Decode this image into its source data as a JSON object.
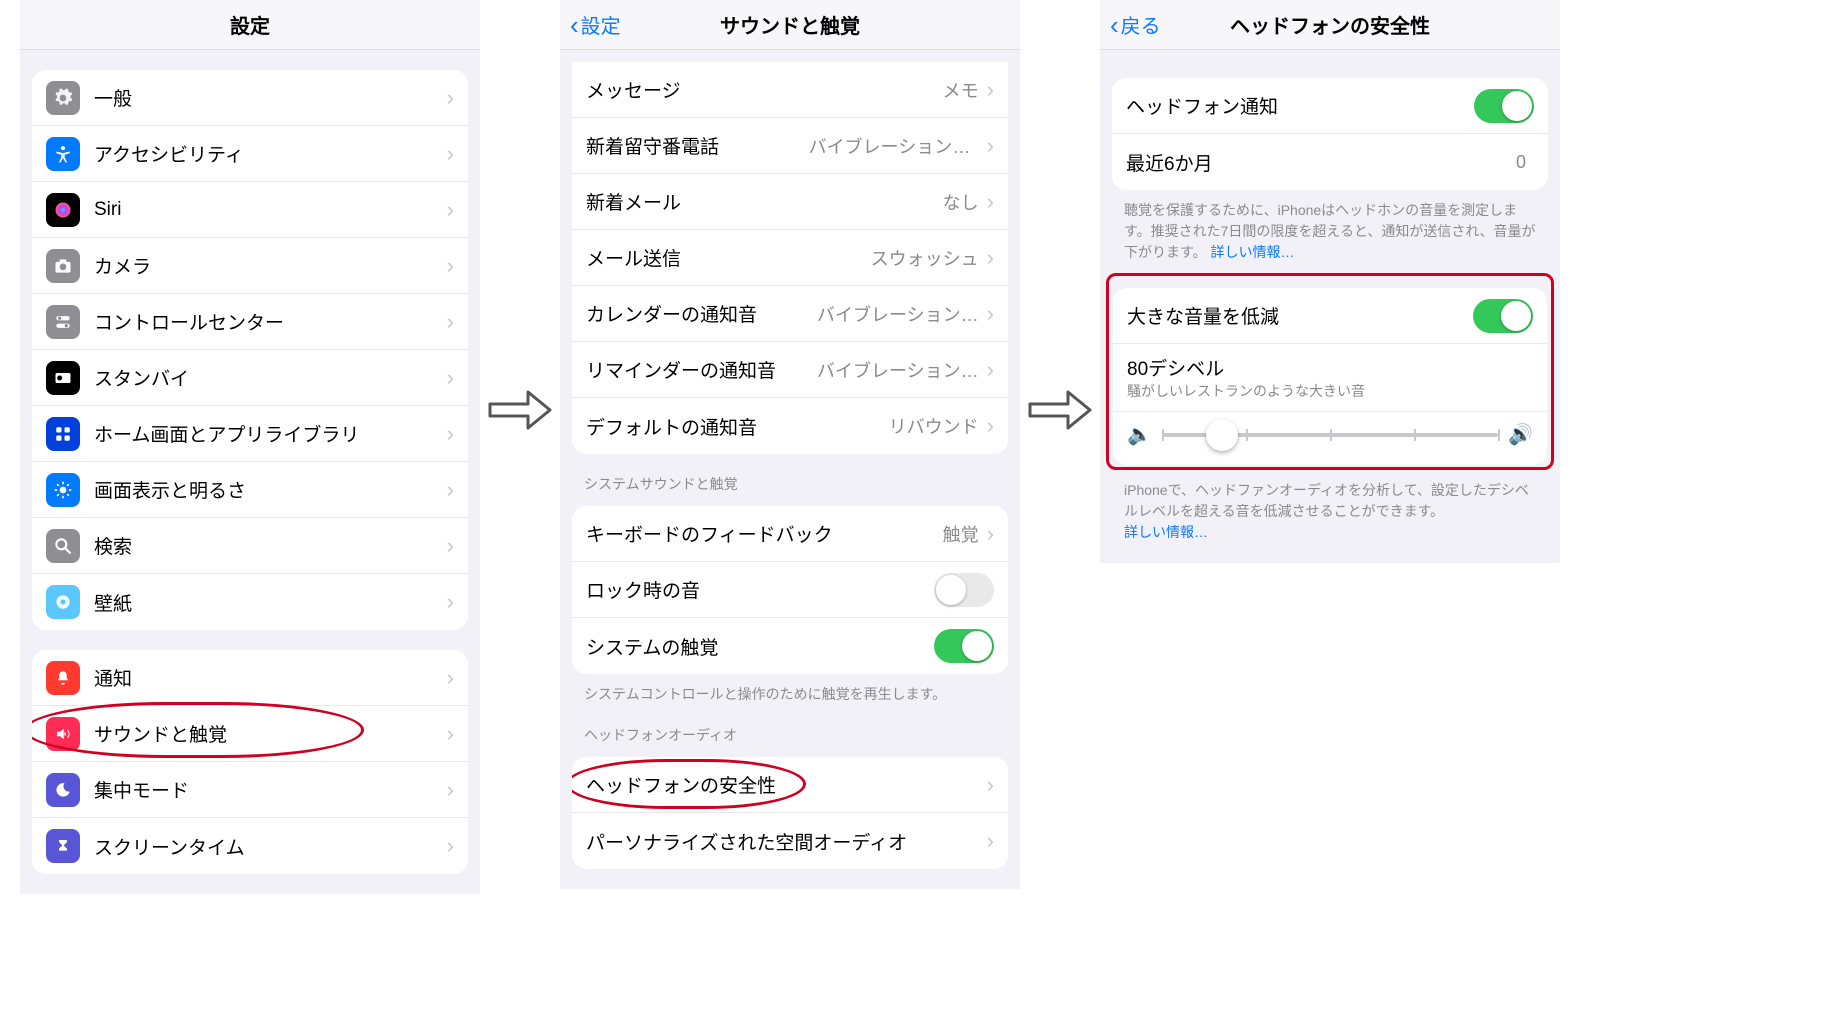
{
  "screens": {
    "s1": {
      "title": "設定",
      "group1": [
        {
          "label": "一般",
          "icon": "gear",
          "bg": "bg-grey"
        },
        {
          "label": "アクセシビリティ",
          "icon": "access",
          "bg": "bg-blue"
        },
        {
          "label": "Siri",
          "icon": "siri",
          "bg": "bg-black"
        },
        {
          "label": "カメラ",
          "icon": "camera",
          "bg": "bg-grey"
        },
        {
          "label": "コントロールセンター",
          "icon": "switches",
          "bg": "bg-grey"
        },
        {
          "label": "スタンバイ",
          "icon": "standby",
          "bg": "bg-black"
        },
        {
          "label": "ホーム画面とアプリライブラリ",
          "icon": "grid",
          "bg": "bg-dkblue"
        },
        {
          "label": "画面表示と明るさ",
          "icon": "brightness",
          "bg": "bg-blue"
        },
        {
          "label": "検索",
          "icon": "search",
          "bg": "bg-grey"
        },
        {
          "label": "壁紙",
          "icon": "wallpaper",
          "bg": "bg-bluel"
        }
      ],
      "group2": [
        {
          "label": "通知",
          "icon": "bell",
          "bg": "bg-red"
        },
        {
          "label": "サウンドと触覚",
          "icon": "sound",
          "bg": "bg-pink",
          "highlight": true
        },
        {
          "label": "集中モード",
          "icon": "moon",
          "bg": "bg-purple"
        },
        {
          "label": "スクリーンタイム",
          "icon": "hourglass",
          "bg": "bg-purple"
        }
      ]
    },
    "s2": {
      "back": "設定",
      "title": "サウンドと触覚",
      "group1": [
        {
          "label": "メッセージ",
          "value": "メモ"
        },
        {
          "label": "新着留守番電話",
          "value": "バイブレーションのみ"
        },
        {
          "label": "新着メール",
          "value": "なし"
        },
        {
          "label": "メール送信",
          "value": "スウォッシュ"
        },
        {
          "label": "カレンダーの通知音",
          "value": "バイブレーション…"
        },
        {
          "label": "リマインダーの通知音",
          "value": "バイブレーション…"
        },
        {
          "label": "デフォルトの通知音",
          "value": "リバウンド"
        }
      ],
      "header2": "システムサウンドと触覚",
      "group2": [
        {
          "label": "キーボードのフィードバック",
          "value": "触覚",
          "type": "nav"
        },
        {
          "label": "ロック時の音",
          "type": "toggle",
          "on": false
        },
        {
          "label": "システムの触覚",
          "type": "toggle",
          "on": true
        }
      ],
      "note2": "システムコントロールと操作のために触覚を再生します。",
      "header3": "ヘッドフォンオーディオ",
      "group3": [
        {
          "label": "ヘッドフォンの安全性",
          "highlight": true
        },
        {
          "label": "パーソナライズされた空間オーディオ"
        }
      ]
    },
    "s3": {
      "back": "戻る",
      "title": "ヘッドフォンの安全性",
      "row1": {
        "label": "ヘッドフォン通知",
        "on": true
      },
      "row2": {
        "label": "最近6か月",
        "value": "0"
      },
      "note1": "聴覚を保護するために、iPhoneはヘッドホンの音量を測定します。推奨された7日間の限度を超えると、通知が送信され、音量が下がります。",
      "link1": "詳しい情報…",
      "reduce": {
        "label": "大きな音量を低減",
        "on": true
      },
      "db": {
        "label": "80デシベル",
        "sub": "騒がしいレストランのような大きい音"
      },
      "slider": {
        "pos": 0.18
      },
      "note2": "iPhoneで、ヘッドファンオーディオを分析して、設定したデシベルレベルを超える音を低減させることができます。",
      "link2": "詳しい情報…"
    }
  }
}
